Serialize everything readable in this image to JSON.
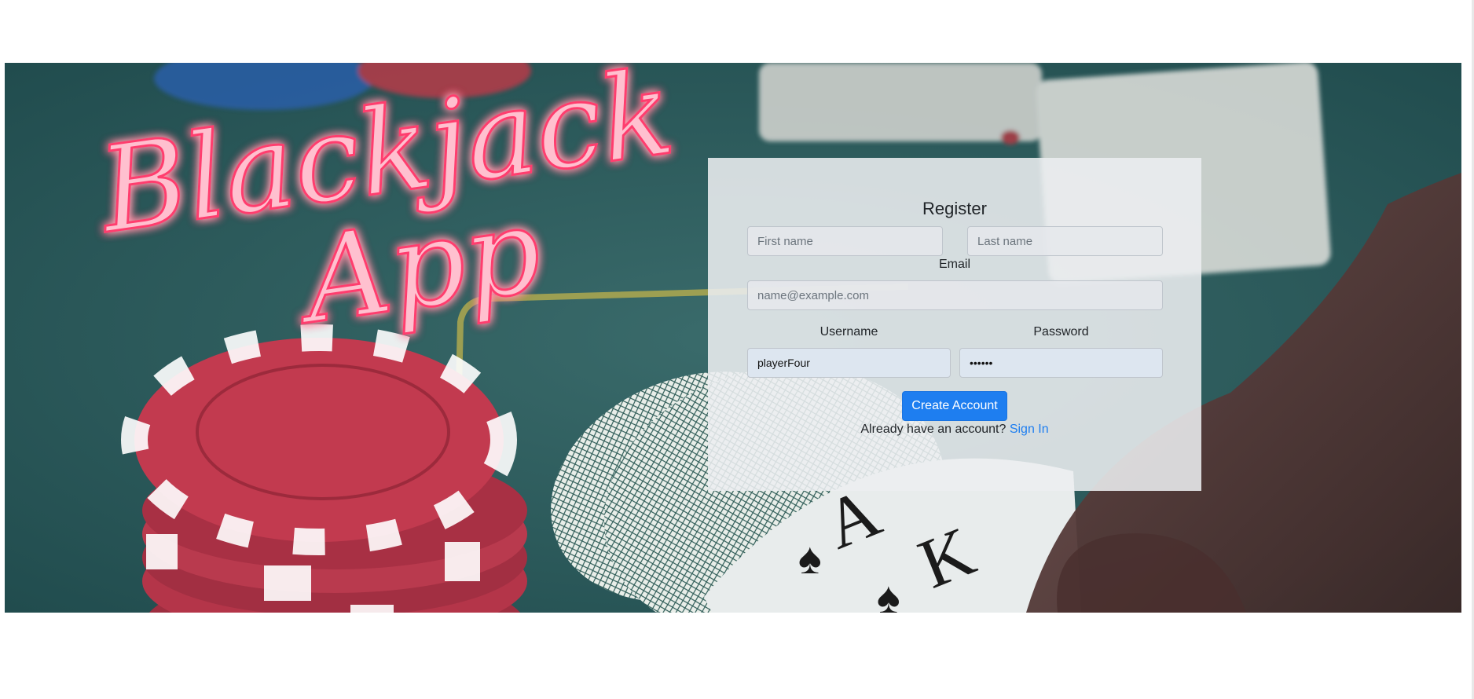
{
  "hero": {
    "logo_line1": "Blackjack",
    "logo_line2": "App"
  },
  "register": {
    "title": "Register",
    "first_name": {
      "placeholder": "First name",
      "value": ""
    },
    "last_name": {
      "placeholder": "Last name",
      "value": ""
    },
    "email": {
      "label": "Email",
      "placeholder": "name@example.com",
      "value": ""
    },
    "username": {
      "label": "Username",
      "value": "playerFour"
    },
    "password": {
      "label": "Password",
      "value": "••••••"
    },
    "submit_label": "Create Account",
    "signin_prompt": "Already have an account?",
    "signin_link": "Sign In"
  },
  "colors": {
    "accent": "#1e7ef0",
    "neon": "#ff4d7a",
    "felt": "#2f5a5a",
    "chip_red": "#c23a4f"
  }
}
